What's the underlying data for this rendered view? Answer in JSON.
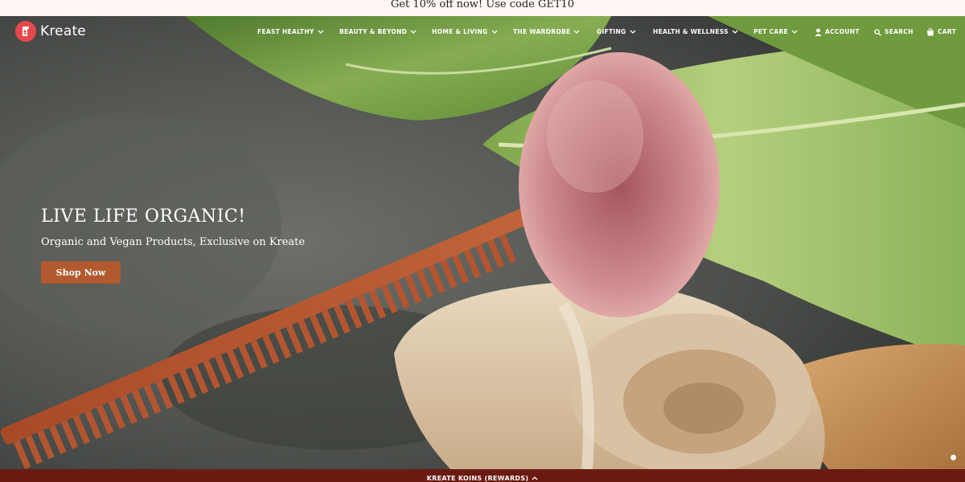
{
  "announcement": {
    "text": "Get 10% off now! Use code GET10"
  },
  "brand": {
    "name": "Kreate",
    "logo_color": "#e8474c"
  },
  "nav": {
    "items": [
      {
        "label": "FEAST HEALTHY",
        "icon": "chevron-down-icon"
      },
      {
        "label": "BEAUTY & BEYOND",
        "icon": "chevron-down-icon"
      },
      {
        "label": "HOME & LIVING",
        "icon": "chevron-down-icon"
      },
      {
        "label": "THE WARDROBE",
        "icon": "chevron-down-icon"
      },
      {
        "label": "GIFTING",
        "icon": "chevron-down-icon"
      },
      {
        "label": "HEALTH & WELLNESS",
        "icon": "chevron-down-icon"
      },
      {
        "label": "PET CARE",
        "icon": "chevron-down-icon"
      }
    ],
    "account_label": "ACCOUNT",
    "search_label": "SEARCH",
    "cart_label": "CART"
  },
  "hero": {
    "title": "LIVE LIFE ORGANIC!",
    "subtitle": "Organic and Vegan Products, Exclusive on Kreate",
    "cta_label": "Shop Now",
    "cta_color": "#b2592f"
  },
  "rewards": {
    "label": "KREATE KOINS (REWARDS)",
    "color": "#6b1a12"
  }
}
